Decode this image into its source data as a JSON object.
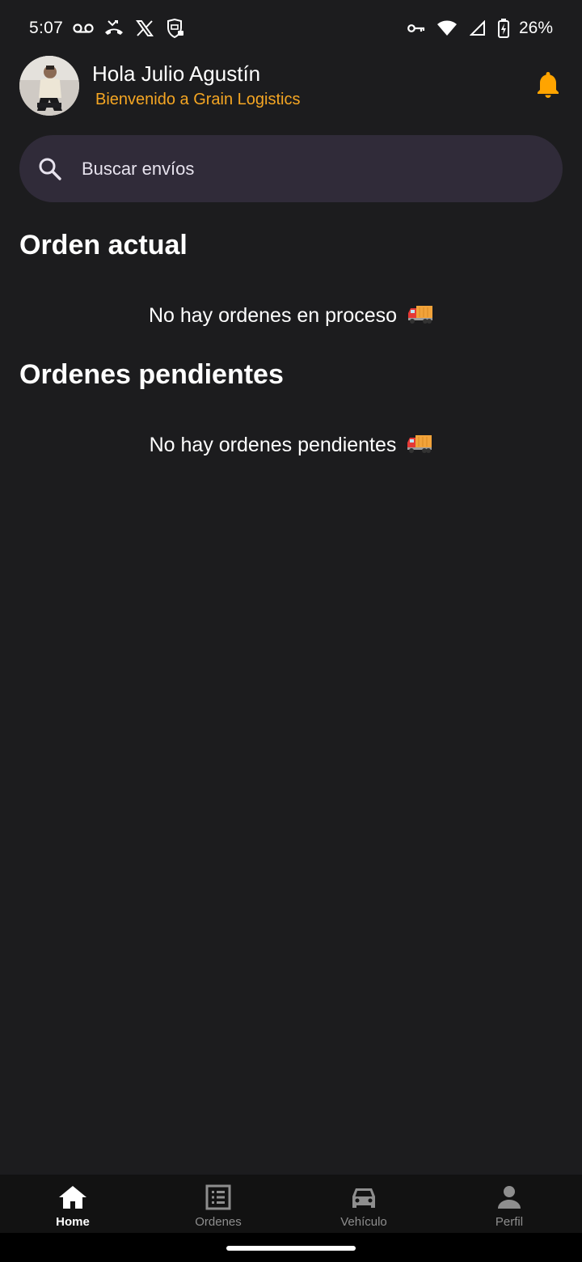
{
  "status_bar": {
    "time": "5:07",
    "battery": "26%",
    "icons_left": [
      "voicemail-icon",
      "missed-call-icon",
      "x-logo-icon",
      "vpn-shield-icon"
    ],
    "icons_right": [
      "key-icon",
      "wifi-icon",
      "signal-icon",
      "battery-charging-icon"
    ]
  },
  "header": {
    "greeting": "Hola Julio Agustín",
    "welcome": "Bienvenido a Grain Logistics",
    "accent_color": "#f5a623"
  },
  "search": {
    "placeholder": "Buscar envíos"
  },
  "sections": {
    "current": {
      "title": "Orden actual",
      "empty_message": "No hay ordenes en proceso"
    },
    "pending": {
      "title": "Ordenes pendientes",
      "empty_message": "No hay ordenes pendientes"
    }
  },
  "bottom_nav": {
    "items": [
      {
        "label": "Home",
        "icon": "home-icon",
        "active": true
      },
      {
        "label": "Ordenes",
        "icon": "list-icon",
        "active": false
      },
      {
        "label": "Vehículo",
        "icon": "car-icon",
        "active": false
      },
      {
        "label": "Perfil",
        "icon": "person-icon",
        "active": false
      }
    ]
  }
}
